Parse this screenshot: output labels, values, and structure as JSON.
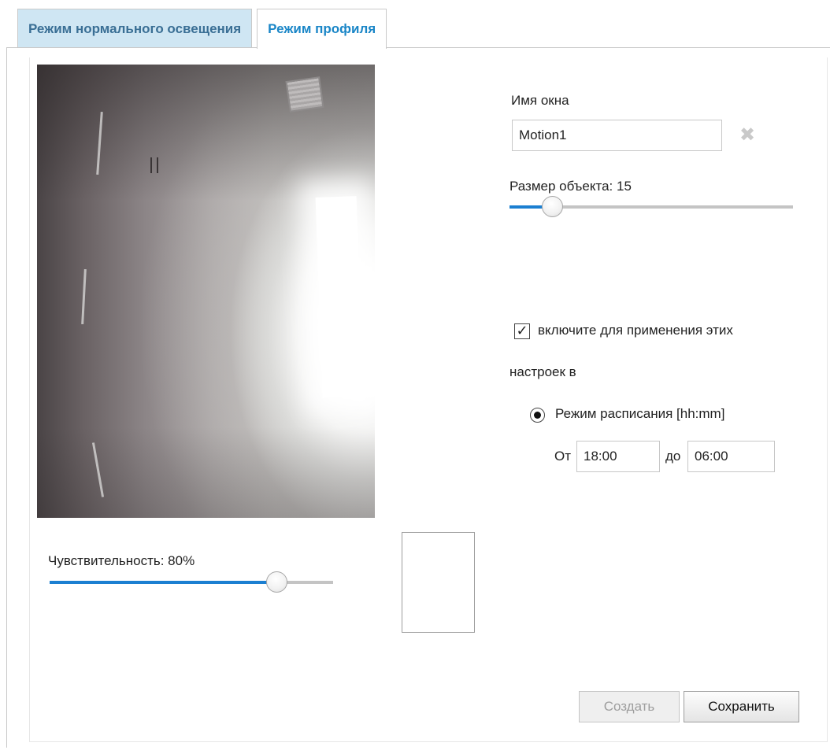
{
  "tabs": [
    {
      "label": "Режим нормального освещения",
      "active": false
    },
    {
      "label": "Режим профиля",
      "active": true
    }
  ],
  "window_name": {
    "label": "Имя окна",
    "value": "Motion1",
    "clear_icon": "close-x-icon"
  },
  "object_size": {
    "label": "Размер объекта: 15",
    "value": 15,
    "fraction": 0.15
  },
  "sensitivity": {
    "label": "Чувствительность: 80%",
    "value": 80,
    "fraction": 0.8
  },
  "enable": {
    "checked": true,
    "mark": "✓",
    "label_line1": "включите для применения этих",
    "label_line2": "настроек в"
  },
  "schedule": {
    "selected": true,
    "label": "Режим расписания  [hh:mm]",
    "from_label": "От",
    "from_value": "18:00",
    "to_label": "до",
    "to_value": "06:00"
  },
  "buttons": {
    "create": "Создать",
    "save": "Сохранить"
  },
  "colors": {
    "accent": "#1b7fd1",
    "tab_inactive_bg": "#cfe6f3",
    "tab_active_text": "#1a86c7"
  }
}
